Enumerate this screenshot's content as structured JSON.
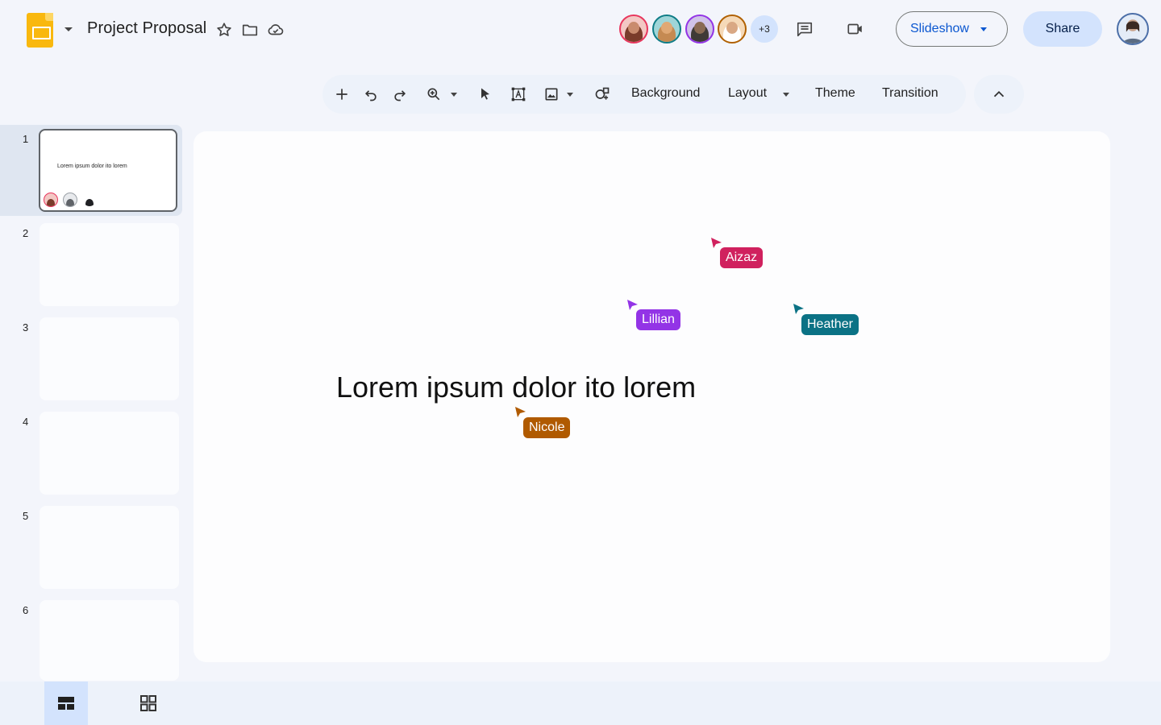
{
  "header": {
    "app_icon": "slides-logo-icon",
    "title": "Project Proposal",
    "icons": [
      "star-icon",
      "folder-icon",
      "cloud-saved-icon"
    ],
    "collaborators": [
      {
        "name": "collaborator-1",
        "ring": "#e8365d"
      },
      {
        "name": "collaborator-2",
        "ring": "#0e7c86"
      },
      {
        "name": "collaborator-3",
        "ring": "#9334e6"
      },
      {
        "name": "collaborator-4",
        "ring": "#b06000"
      }
    ],
    "more_count": "+3",
    "comments_icon": "comment-icon",
    "meet_icon": "video-camera-icon",
    "slideshow_label": "Slideshow",
    "share_label": "Share"
  },
  "toolbar": {
    "icons": [
      "add-icon",
      "undo-icon",
      "redo-icon",
      "zoom-icon",
      "select-icon",
      "text-box-icon",
      "image-icon",
      "shape-icon"
    ],
    "background_label": "Background",
    "layout_label": "Layout",
    "theme_label": "Theme",
    "transition_label": "Transition"
  },
  "filmstrip": {
    "slides": [
      {
        "number": "1",
        "text": "Lorem ipsum dolor ito lorem",
        "selected": true
      },
      {
        "number": "2",
        "text": ""
      },
      {
        "number": "3",
        "text": ""
      },
      {
        "number": "4",
        "text": ""
      },
      {
        "number": "5",
        "text": ""
      },
      {
        "number": "6",
        "text": ""
      }
    ]
  },
  "canvas": {
    "title": "Lorem ipsum dolor ito lorem",
    "cursors": [
      {
        "name": "Aizaz",
        "color": "#d0215e"
      },
      {
        "name": "Lillian",
        "color": "#9334e6"
      },
      {
        "name": "Heather",
        "color": "#0b7285"
      },
      {
        "name": "Nicole",
        "color": "#b05a00"
      }
    ]
  },
  "bottom_bar": {
    "views": [
      "filmstrip-view-icon",
      "grid-view-icon"
    ]
  }
}
